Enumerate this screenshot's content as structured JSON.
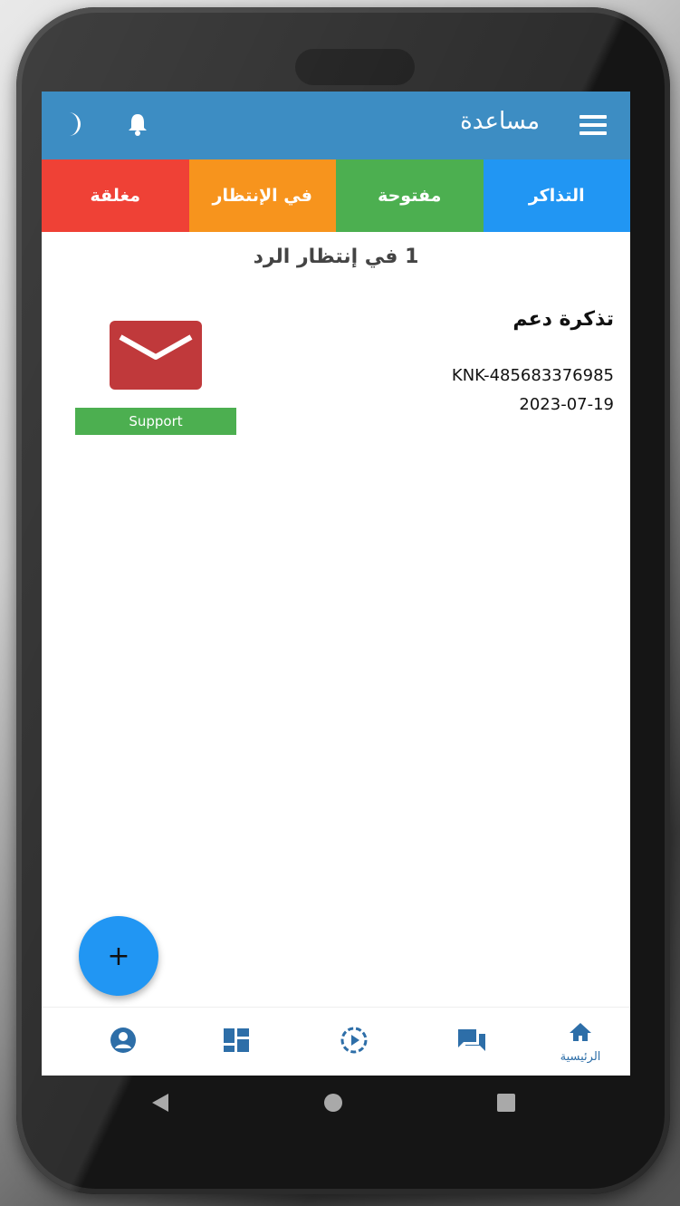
{
  "appbar": {
    "title": "مساعدة",
    "icons": [
      "menu-icon",
      "bell-icon",
      "moon-icon"
    ]
  },
  "tabs": [
    {
      "label": "التذاكر",
      "color": "#2196f3"
    },
    {
      "label": "مفتوحة",
      "color": "#4caf50"
    },
    {
      "label": "في الإنتظار",
      "color": "#f7941d"
    },
    {
      "label": "مغلقة",
      "color": "#ef4136"
    }
  ],
  "status_line": "1 في إنتظار الرد",
  "ticket": {
    "title": "تذكرة دعم",
    "id": "KNK-485683376985",
    "date": "2023-07-19",
    "badge": "Support",
    "icon": "envelope-icon"
  },
  "fab": {
    "label": "+"
  },
  "bottom_nav": {
    "items": [
      {
        "icon": "home-icon",
        "label": "الرئيسية"
      },
      {
        "icon": "chat-icon",
        "label": ""
      },
      {
        "icon": "play-circle-icon",
        "label": ""
      },
      {
        "icon": "dashboard-icon",
        "label": ""
      },
      {
        "icon": "account-icon",
        "label": ""
      }
    ]
  },
  "colors": {
    "appbar": "#3d8dc3",
    "accent": "#2196f3",
    "nav_icon": "#2d6ea8"
  }
}
